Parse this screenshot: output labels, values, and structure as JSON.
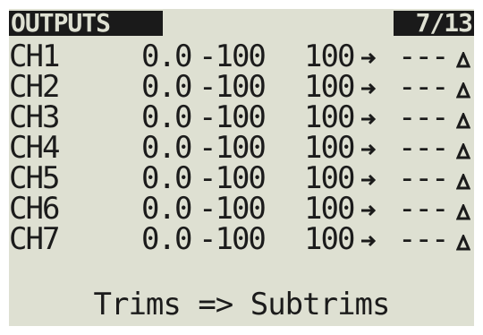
{
  "header": {
    "title": "OUTPUTS",
    "page": "7/13"
  },
  "channels": [
    {
      "name": "CH1",
      "offset": "0.0",
      "min": "-100",
      "max": "100",
      "curve": "---",
      "direction_icon": "arrow-right-icon",
      "symbol_icon": "delta-icon"
    },
    {
      "name": "CH2",
      "offset": "0.0",
      "min": "-100",
      "max": "100",
      "curve": "---",
      "direction_icon": "arrow-right-icon",
      "symbol_icon": "delta-icon"
    },
    {
      "name": "CH3",
      "offset": "0.0",
      "min": "-100",
      "max": "100",
      "curve": "---",
      "direction_icon": "arrow-right-icon",
      "symbol_icon": "delta-icon"
    },
    {
      "name": "CH4",
      "offset": "0.0",
      "min": "-100",
      "max": "100",
      "curve": "---",
      "direction_icon": "arrow-right-icon",
      "symbol_icon": "delta-icon"
    },
    {
      "name": "CH5",
      "offset": "0.0",
      "min": "-100",
      "max": "100",
      "curve": "---",
      "direction_icon": "arrow-right-icon",
      "symbol_icon": "delta-icon"
    },
    {
      "name": "CH6",
      "offset": "0.0",
      "min": "-100",
      "max": "100",
      "curve": "---",
      "direction_icon": "arrow-right-icon",
      "symbol_icon": "delta-icon"
    },
    {
      "name": "CH7",
      "offset": "0.0",
      "min": "-100",
      "max": "100",
      "curve": "---",
      "direction_icon": "arrow-right-icon",
      "symbol_icon": "delta-icon"
    }
  ],
  "footer": {
    "action": "Trims => Subtrims"
  },
  "colors": {
    "lcd_background": "#dee0d2",
    "lcd_text": "#1b1b1b",
    "header_background": "#1a1a1a"
  }
}
